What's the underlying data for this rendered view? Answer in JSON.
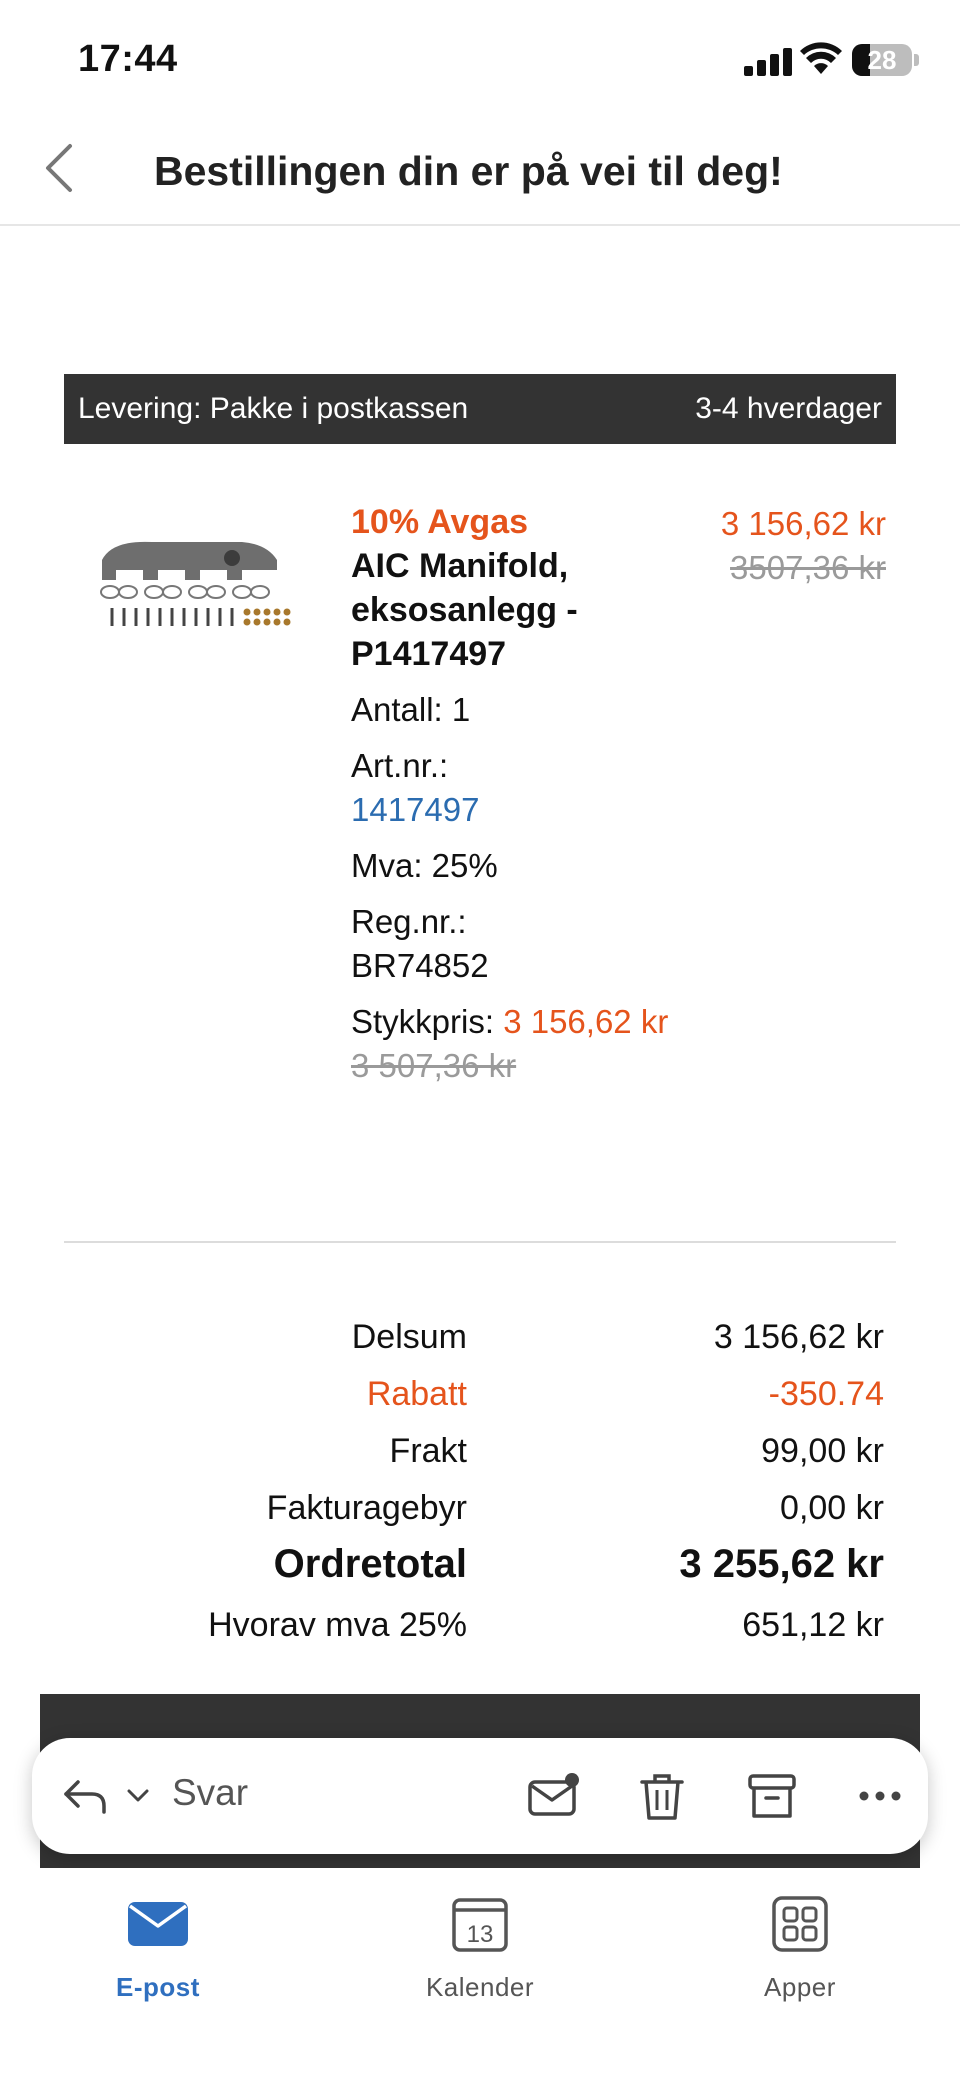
{
  "status_bar": {
    "time": "17:44",
    "battery": "28"
  },
  "header": {
    "title": "Bestillingen din er på vei til deg!"
  },
  "delivery": {
    "method": "Levering: Pakke i postkassen",
    "eta": "3-4 hverdager"
  },
  "product": {
    "promo": "10% Avgas",
    "name": "AIC Manifold, eksosanlegg - P1417497",
    "quantity": "Antall: 1",
    "art_label": "Art.nr.:",
    "art_number": "1417497",
    "vat": "Mva: 25%",
    "reg_label": "Reg.nr.:",
    "reg_number": "BR74852",
    "unit_price_label": "Stykkpris:",
    "unit_price": "3 156,62 kr",
    "unit_price_old": "3 507,36 kr",
    "price": "3 156,62 kr",
    "price_old": "3507,36 kr",
    "image_icon": "exhaust-manifold-image"
  },
  "totals": {
    "subtotal": {
      "label": "Delsum",
      "value": "3 156,62 kr"
    },
    "discount": {
      "label": "Rabatt",
      "value": "-350.74"
    },
    "shipping": {
      "label": "Frakt",
      "value": "99,00 kr"
    },
    "invoice_fee": {
      "label": "Fakturagebyr",
      "value": "0,00 kr"
    },
    "order_total": {
      "label": "Ordretotal",
      "value": "3 255,62 kr"
    },
    "vat_total": {
      "label": "Hvorav mva 25%",
      "value": "651,12 kr"
    }
  },
  "toolbar": {
    "reply_label": "Svar"
  },
  "tabs": [
    {
      "label": "E-post",
      "icon": "mail-icon"
    },
    {
      "label": "Kalender",
      "icon": "calendar-icon",
      "day": "13"
    },
    {
      "label": "Apper",
      "icon": "apps-grid-icon"
    }
  ],
  "colors": {
    "accent_orange": "#e5541c",
    "link_blue": "#2b6cb0",
    "tab_active": "#2f6fbf",
    "dark_bar": "#333333"
  }
}
